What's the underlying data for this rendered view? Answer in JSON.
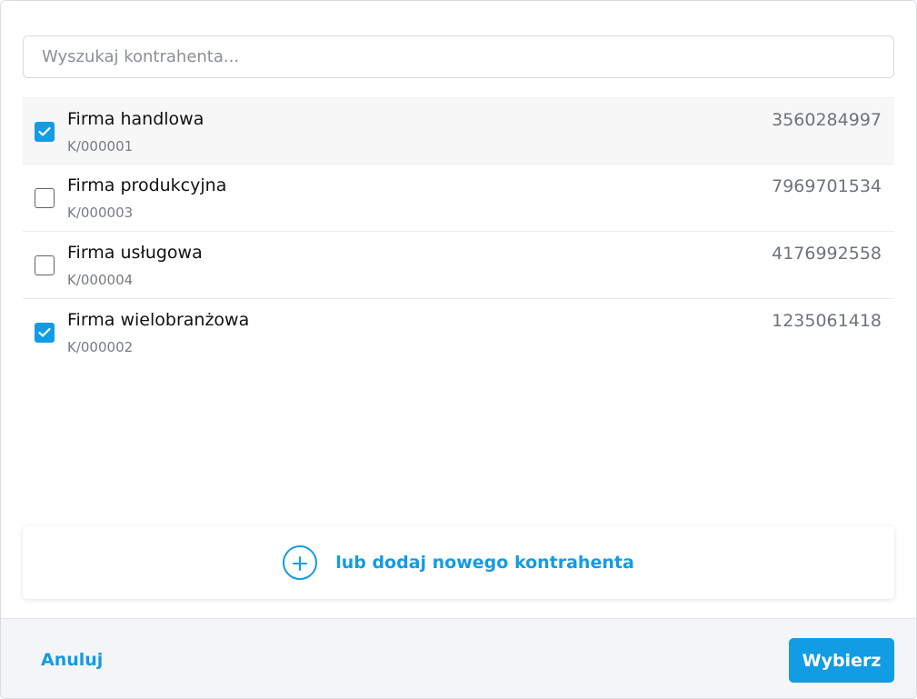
{
  "search": {
    "placeholder": "Wyszukaj kontrahenta...",
    "value": ""
  },
  "contractors": [
    {
      "name": "Firma handlowa",
      "code": "K/000001",
      "nip": "3560284997",
      "checked": true
    },
    {
      "name": "Firma produkcyjna",
      "code": "K/000003",
      "nip": "7969701534",
      "checked": false
    },
    {
      "name": "Firma usługowa",
      "code": "K/000004",
      "nip": "4176992558",
      "checked": false
    },
    {
      "name": "Firma wielobranżowa",
      "code": "K/000002",
      "nip": "1235061418",
      "checked": true
    }
  ],
  "add": {
    "label": "lub dodaj nowego kontrahenta",
    "icon": "plus-circle-icon"
  },
  "footer": {
    "cancel_label": "Anuluj",
    "select_label": "Wybierz"
  },
  "colors": {
    "accent": "#129ce4",
    "footer_bg": "#f4f5f7"
  }
}
